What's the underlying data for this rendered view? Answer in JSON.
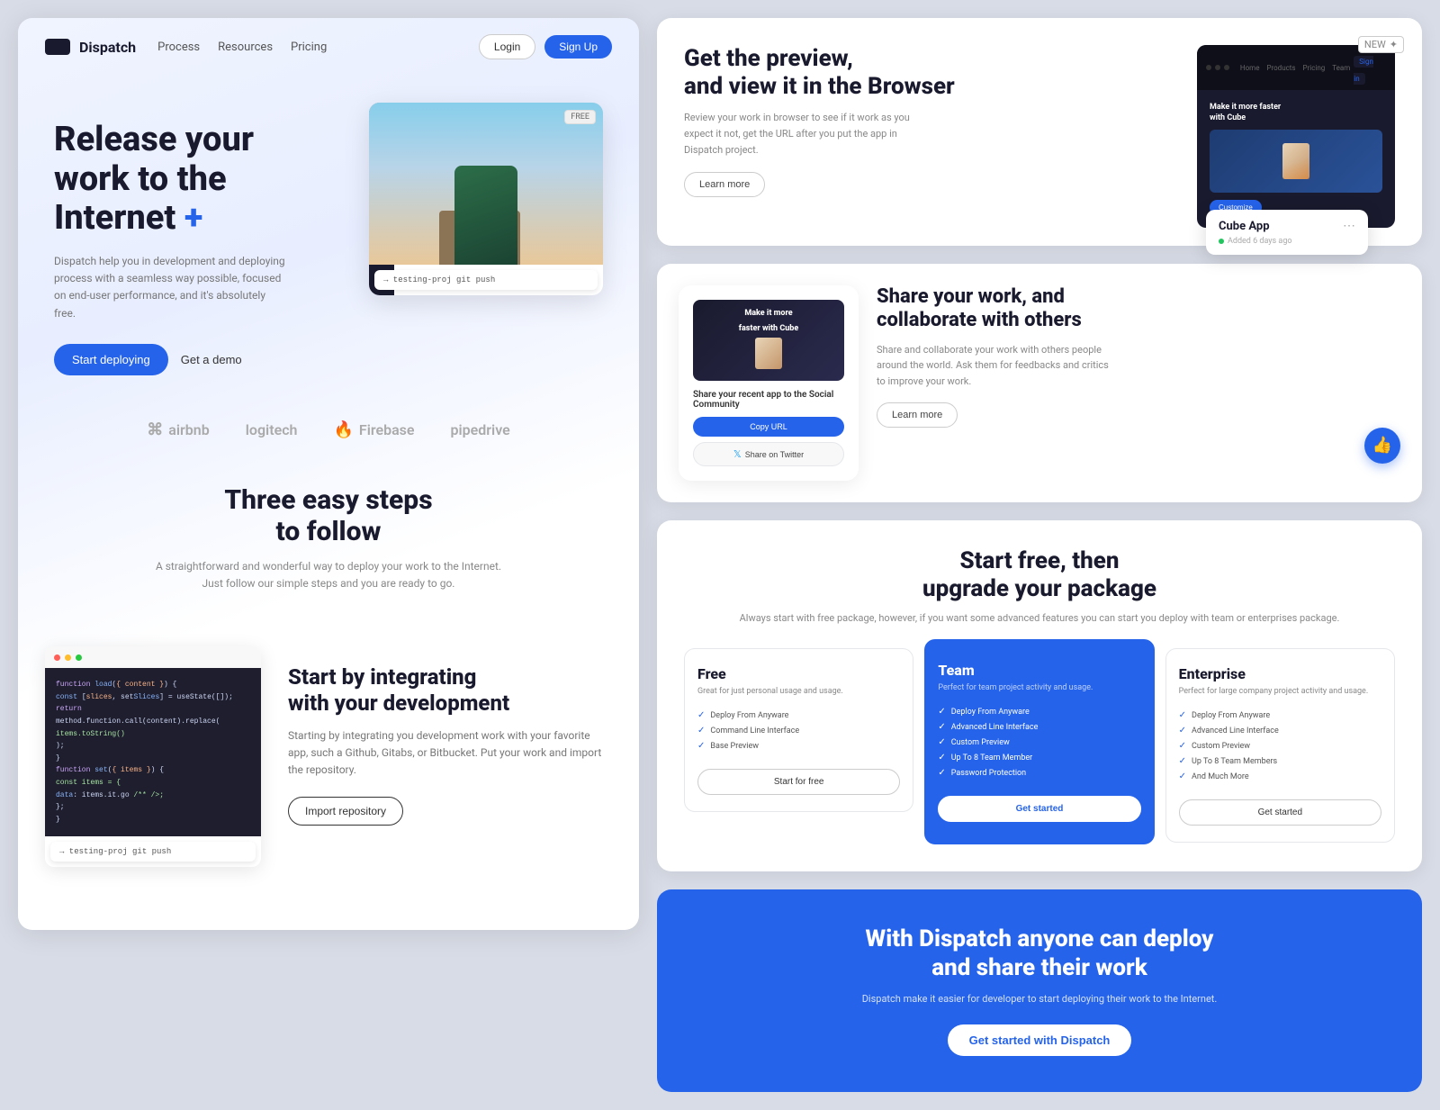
{
  "brand": {
    "name": "Dispatch",
    "logo_alt": "Dispatch logo"
  },
  "nav": {
    "links": [
      "Process",
      "Resources",
      "Pricing"
    ],
    "login": "Login",
    "signup": "Sign Up"
  },
  "hero": {
    "title_line1": "Release your",
    "title_line2": "work to the",
    "title_line3": "Internet",
    "plus": "+",
    "description": "Dispatch help you in development and deploying process with a seamless way possible, focused on end-user performance, and it's absolutely free.",
    "cta_primary": "Start deploying",
    "cta_secondary": "Get a demo",
    "free_badge": "FREE",
    "cmd_text": "→ testing-proj git push"
  },
  "logos": [
    "airbnb",
    "logitech",
    "Firebase",
    "pipedrive"
  ],
  "steps": {
    "title_line1": "Three easy steps",
    "title_line2": "to follow",
    "description": "A straightforward and wonderful way to deploy your work to the Internet. Just follow our simple steps and you are ready to go."
  },
  "integration": {
    "title_line1": "Start by integrating",
    "title_line2": "with your development",
    "description": "Starting by integrating you development work with your favorite app, such a Github, Gitabs, or Bitbucket. Put your work and import the repository.",
    "cta": "Import repository",
    "cmd_text": "→ testing-proj git push"
  },
  "browser": {
    "title_line1": "Get the preview,",
    "title_line2": "and view it in the Browser",
    "description": "Review your work in browser to see if it work as you expect it not, get the URL after you put the app in Dispatch project.",
    "learn_more": "Learn more",
    "app": {
      "name": "Make it more faster with Cube",
      "btn": "Customize"
    }
  },
  "cube_app": {
    "name": "Cube App",
    "meta": "Added 6 days ago",
    "new_badge": "NEW"
  },
  "share": {
    "title_line1": "Share your work, and",
    "title_line2": "collaborate with others",
    "description": "Share and collaborate your work with others people around the world. Ask them for feedbacks and critics to improve your work.",
    "learn_more": "Learn more",
    "card_caption": "Share your recent app to the Social Community",
    "btn_copy": "Copy URL",
    "btn_twitter": "Share on Twitter"
  },
  "pricing": {
    "title_line1": "Start free, then",
    "title_line2": "upgrade your package",
    "description": "Always start with free package, however, if you want some advanced features you can start you deploy with team or enterprises package.",
    "plans": [
      {
        "name": "Free",
        "subtitle": "Great for just personal usage and usage.",
        "features": [
          "Deploy From Anyware",
          "Command Line Interface",
          "Base Preview"
        ],
        "btn": "Start for free",
        "featured": false
      },
      {
        "name": "Team",
        "subtitle": "Perfect for team project activity and usage.",
        "features": [
          "Deploy From Anyware",
          "Advanced Line Interface",
          "Custom Preview",
          "Up To 8 Team Member",
          "Password Protection"
        ],
        "btn": "Get started",
        "featured": true
      },
      {
        "name": "Enterprise",
        "subtitle": "Perfect for large company project activity and usage.",
        "features": [
          "Deploy From Anyware",
          "Advanced Line Interface",
          "Custom Preview",
          "Up To 8 Team Members",
          "And Much More"
        ],
        "btn": "Get started",
        "featured": false
      }
    ]
  },
  "cta": {
    "title_line1": "With Dispatch anyone can deploy",
    "title_line2": "and share their work",
    "description": "Dispatch make it easier for developer to start deploying their work to the Internet.",
    "btn": "Get started with Dispatch"
  }
}
